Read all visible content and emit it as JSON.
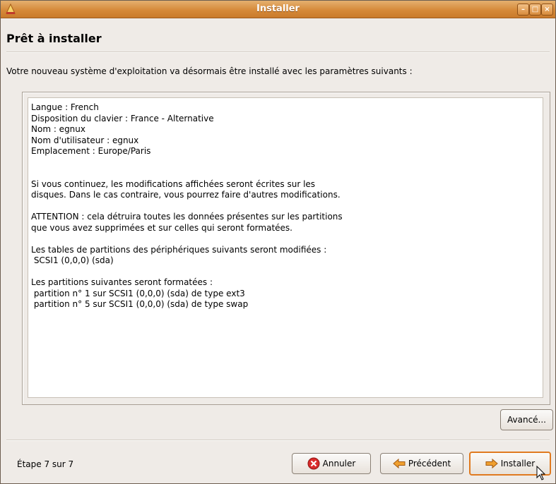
{
  "window": {
    "title": "Installer",
    "minimize_icon": "minimize-icon",
    "maximize_icon": "maximize-icon",
    "close_icon": "close-icon"
  },
  "page": {
    "title": "Prêt à installer",
    "intro": "Votre nouveau système d'exploitation va désormais être installé avec les paramètres suivants :"
  },
  "summary": {
    "lines": [
      "Langue : French",
      "Disposition du clavier : France - Alternative",
      "Nom : egnux",
      "Nom d'utilisateur : egnux",
      "Emplacement : Europe/Paris",
      "",
      "",
      "Si vous continuez, les modifications affichées seront écrites sur les",
      "disques. Dans le cas contraire, vous pourrez faire d'autres modifications.",
      "",
      "ATTENTION : cela détruira toutes les données présentes sur les partitions",
      "que vous avez supprimées et sur celles qui seront formatées.",
      "",
      "Les tables de partitions des périphériques suivants seront modifiées :",
      " SCSI1 (0,0,0) (sda)",
      "",
      "Les partitions suivantes seront formatées :",
      " partition n° 1 sur SCSI1 (0,0,0) (sda) de type ext3",
      " partition n° 5 sur SCSI1 (0,0,0) (sda) de type swap"
    ]
  },
  "buttons": {
    "advanced": "Avancé...",
    "cancel": "Annuler",
    "back": "Précédent",
    "install": "Installer"
  },
  "footer": {
    "step": "Étape 7 sur 7"
  },
  "colors": {
    "titlebar": "#d68a3a",
    "focus": "#e07a1f",
    "background": "#efebe7"
  }
}
